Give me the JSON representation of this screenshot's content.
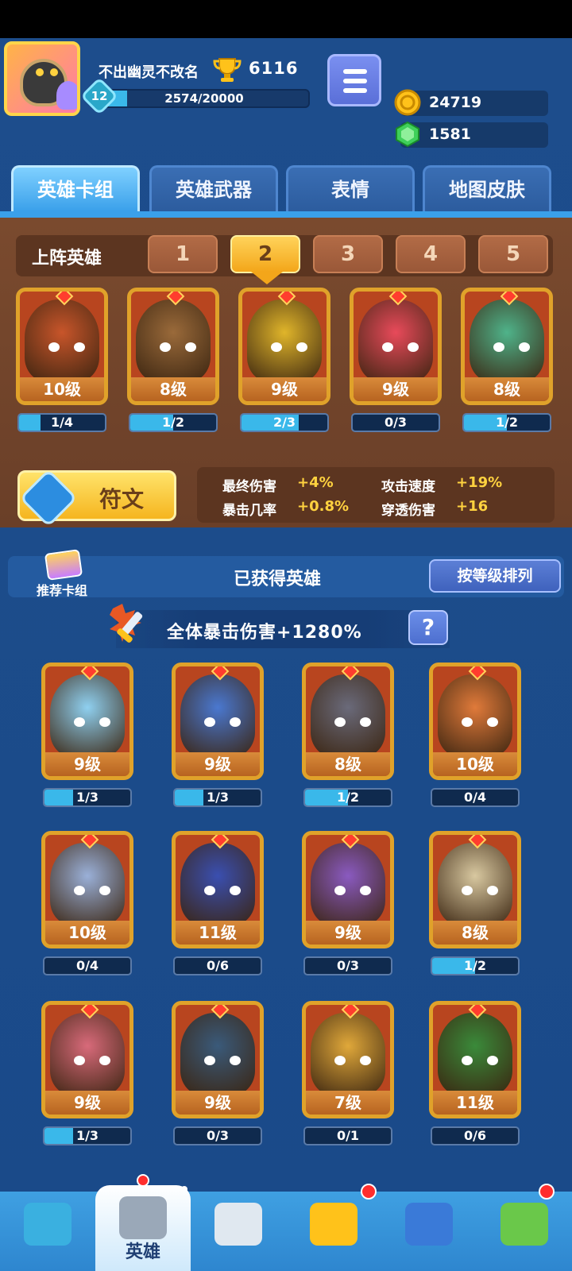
{
  "profile": {
    "name": "不出幽灵不改名",
    "level": "12",
    "trophies": "6116",
    "xp": "2574/20000",
    "xp_progress": 0.13
  },
  "currency": {
    "gold": "24719",
    "gems": "1581"
  },
  "tabs": [
    "英雄卡组",
    "英雄武器",
    "表情",
    "地图皮肤"
  ],
  "deck": {
    "label": "上阵英雄",
    "slots": [
      "1",
      "2",
      "3",
      "4",
      "5"
    ],
    "active_slot": 2,
    "heroes": [
      {
        "level": "10级",
        "progress": "1/4",
        "fill": 0.25,
        "color": "#c8552a"
      },
      {
        "level": "8级",
        "progress": "1/2",
        "fill": 0.5,
        "color": "#9a6a3a"
      },
      {
        "level": "9级",
        "progress": "2/3",
        "fill": 0.67,
        "color": "#e0b52a"
      },
      {
        "level": "9级",
        "progress": "0/3",
        "fill": 0,
        "color": "#e84a5a"
      },
      {
        "level": "8级",
        "progress": "1/2",
        "fill": 0.5,
        "color": "#4fb38a"
      }
    ]
  },
  "rune": {
    "label": "符文",
    "stats": [
      {
        "name": "最终伤害",
        "value": "+4%"
      },
      {
        "name": "攻击速度",
        "value": "+19%"
      },
      {
        "name": "暴击几率",
        "value": "+0.8%"
      },
      {
        "name": "穿透伤害",
        "value": "+16"
      }
    ]
  },
  "collection": {
    "recommend_label": "推荐卡组",
    "title": "已获得英雄",
    "sort_label": "按等级排列",
    "bonus": "全体暴击伤害+1280%",
    "help_label": "?",
    "heroes": [
      {
        "level": "9级",
        "progress": "1/3",
        "fill": 0.33,
        "color": "#8fd0f0"
      },
      {
        "level": "9级",
        "progress": "1/3",
        "fill": 0.33,
        "color": "#4a78d0"
      },
      {
        "level": "8级",
        "progress": "1/2",
        "fill": 0.5,
        "color": "#6a6a7a"
      },
      {
        "level": "10级",
        "progress": "0/4",
        "fill": 0,
        "color": "#e07a3a"
      },
      {
        "level": "10级",
        "progress": "0/4",
        "fill": 0,
        "color": "#9ab0d8"
      },
      {
        "level": "11级",
        "progress": "0/6",
        "fill": 0,
        "color": "#3a4fb0"
      },
      {
        "level": "9级",
        "progress": "0/3",
        "fill": 0,
        "color": "#8a5ac0"
      },
      {
        "level": "8级",
        "progress": "1/2",
        "fill": 0.5,
        "color": "#d8c8a0"
      },
      {
        "level": "9级",
        "progress": "1/3",
        "fill": 0.33,
        "color": "#d86a7a"
      },
      {
        "level": "9级",
        "progress": "0/3",
        "fill": 0,
        "color": "#3a5a7a"
      },
      {
        "level": "7级",
        "progress": "0/1",
        "fill": 0,
        "color": "#e0a83a"
      },
      {
        "level": "11级",
        "progress": "0/6",
        "fill": 0,
        "color": "#3a8a3a"
      }
    ]
  },
  "nav": {
    "items": [
      {
        "icon": "treasure-chest-icon",
        "label": ""
      },
      {
        "icon": "helmet-icon",
        "label": "英雄"
      },
      {
        "icon": "crossed-swords-icon",
        "label": ""
      },
      {
        "icon": "crown-laurel-icon",
        "label": ""
      },
      {
        "icon": "friends-icon",
        "label": ""
      },
      {
        "icon": "island-icon",
        "label": ""
      }
    ]
  }
}
